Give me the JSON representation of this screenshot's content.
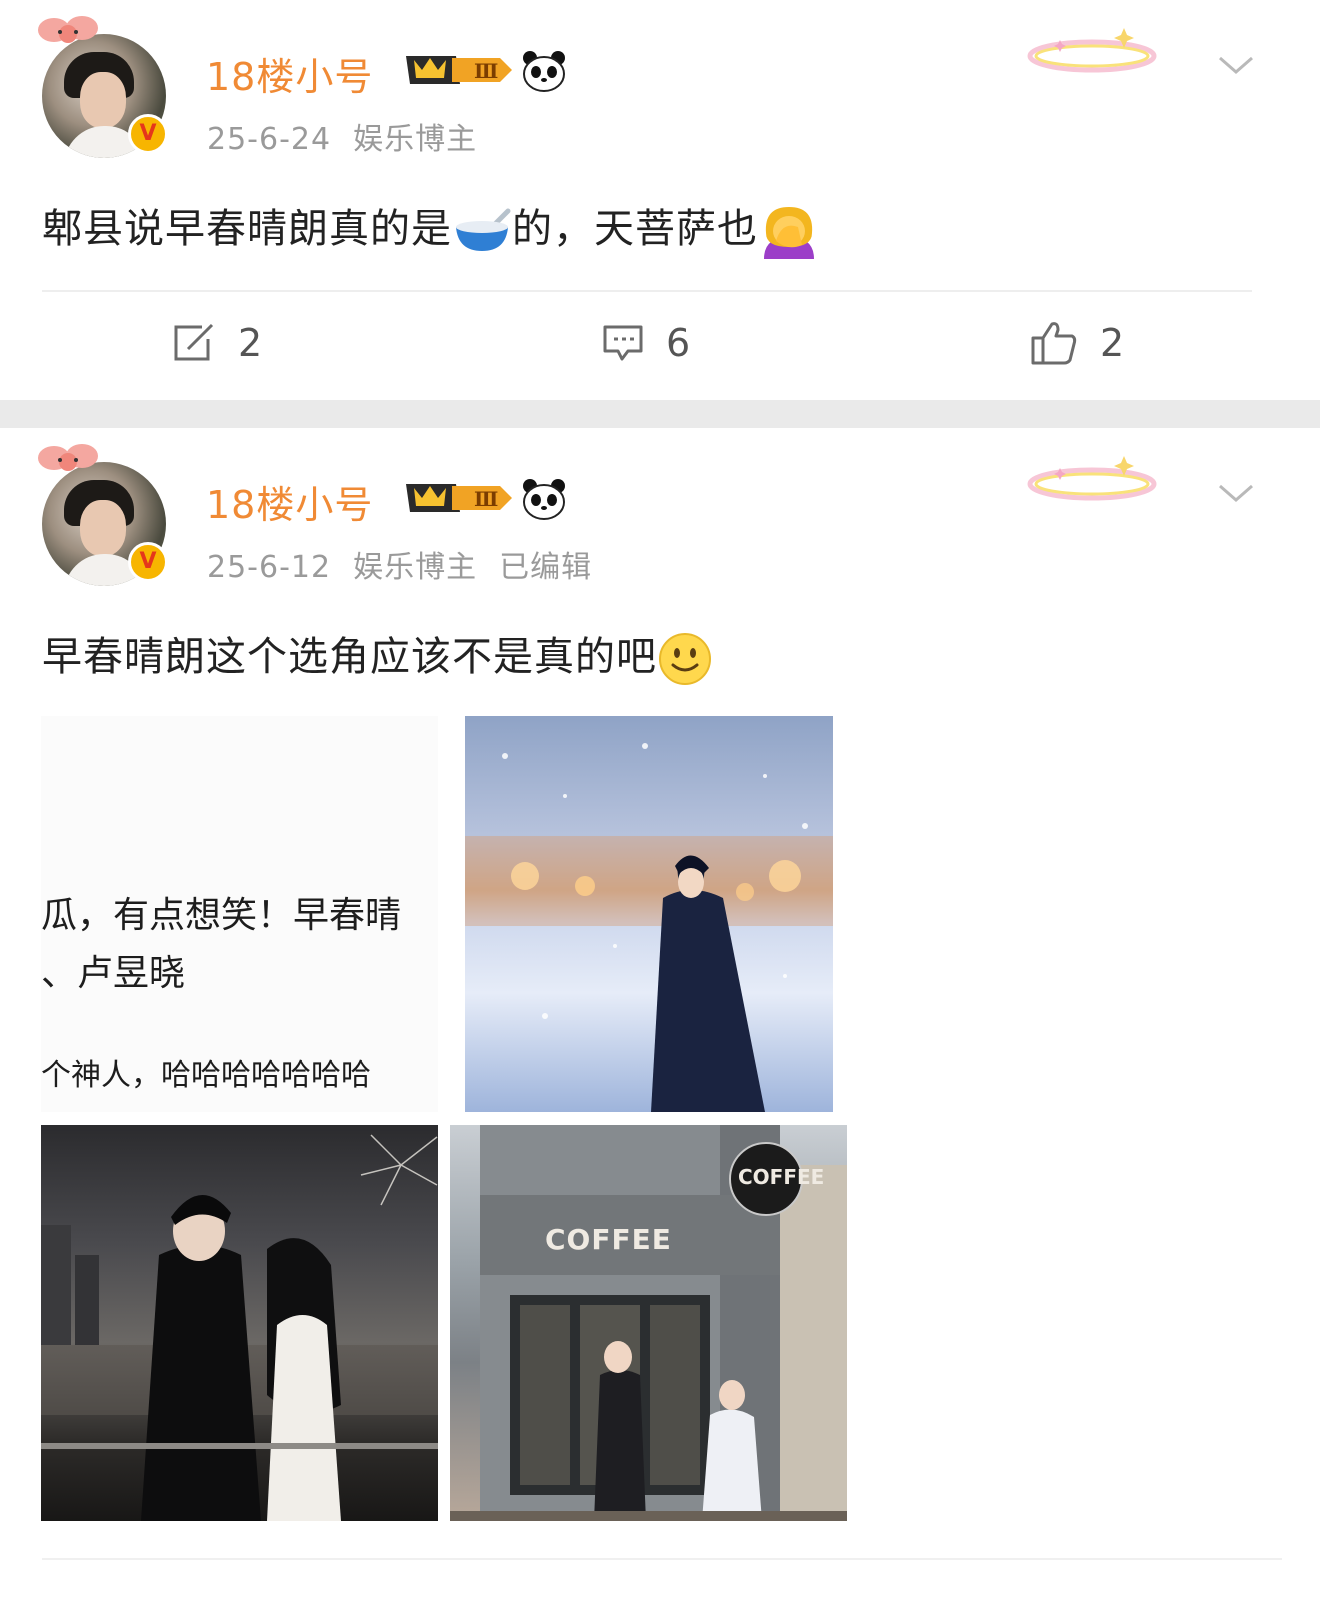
{
  "posts": [
    {
      "username": "18楼小号",
      "date": "25-6-24",
      "category": "娱乐博主",
      "edited": "",
      "text_before": "郫县说早春晴朗真的是",
      "text_mid": "的，天菩萨也",
      "emoji1": "bowl-spoon-emoji",
      "emoji2": "facepalm-emoji",
      "repost_count": "2",
      "comment_count": "6",
      "like_count": "2"
    },
    {
      "username": "18楼小号",
      "date": "25-6-12",
      "category": "娱乐博主",
      "edited": "已编辑",
      "text": "早春晴朗这个选角应该不是真的吧",
      "emoji": "slight-smile-emoji",
      "images": [
        {
          "kind": "text-screenshot",
          "lines": [
            "瓜，有点想笑！早春晴",
            "、卢昱晓",
            "个神人，哈哈哈哈哈哈哈"
          ]
        },
        {
          "kind": "illustration",
          "desc_icon": "man-in-snow-image"
        },
        {
          "kind": "illustration",
          "desc_icon": "couple-fireworks-image"
        },
        {
          "kind": "illustration",
          "signs": [
            "COFFEE",
            "COFFEE"
          ]
        }
      ]
    }
  ],
  "colors": {
    "username": "#f08a35",
    "meta": "#9a9a9a",
    "text": "#222222",
    "separator": "#eaeaea",
    "verified": "#f7b500"
  }
}
